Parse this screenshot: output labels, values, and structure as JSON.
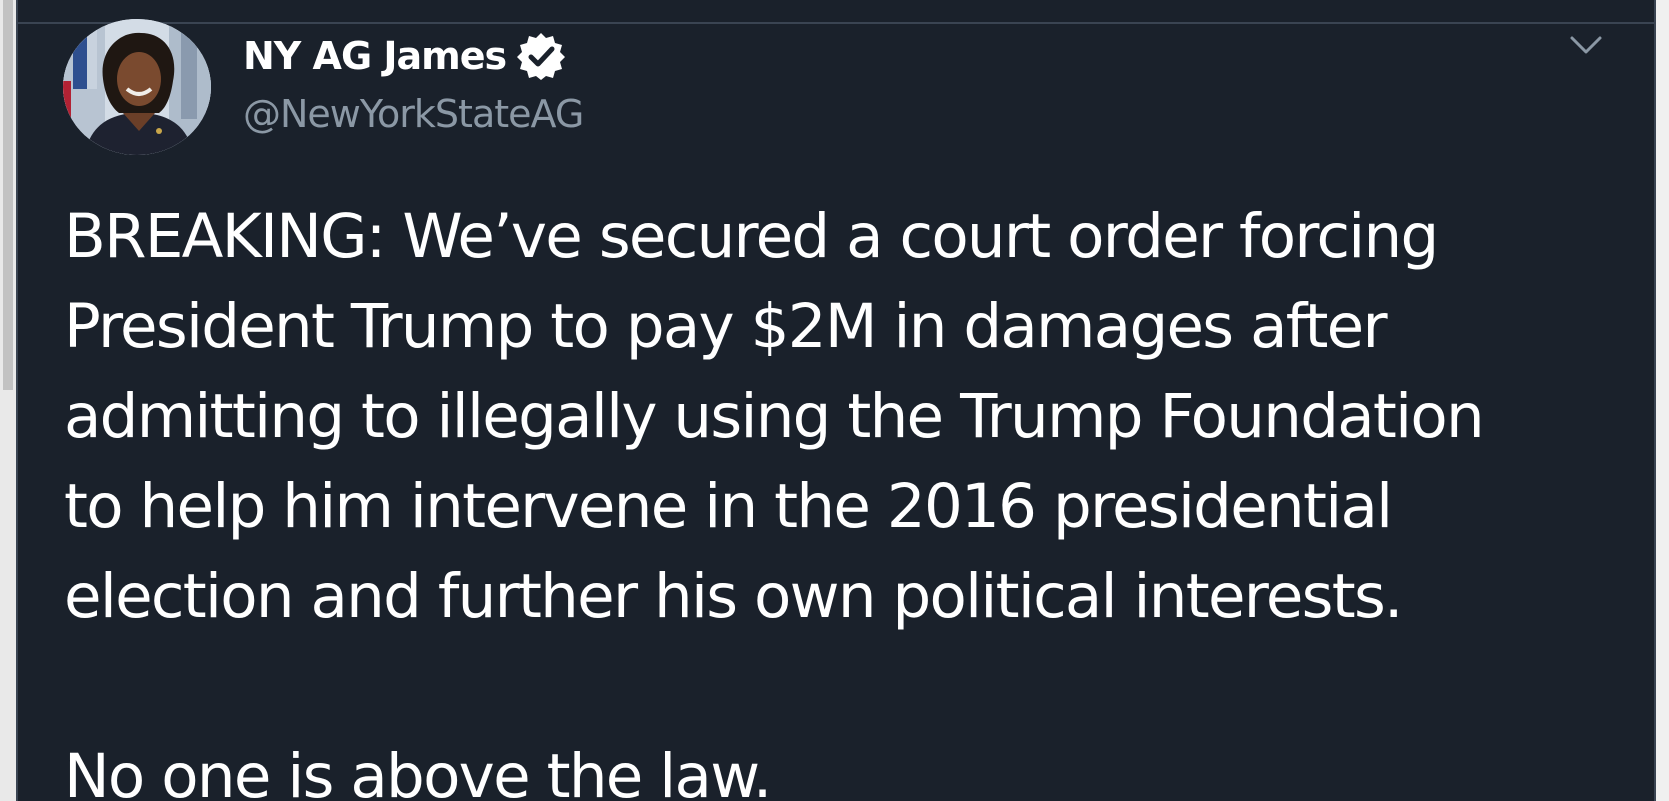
{
  "tweet": {
    "author": {
      "display_name": "NY AG James",
      "handle": "@NewYorkStateAG",
      "verified": true,
      "avatar_icon": "profile-photo"
    },
    "menu_icon": "chevron-down-icon",
    "text_lines": [
      "BREAKING: We’ve secured a court order forcing",
      "President Trump to pay $2M in damages after",
      "admitting to illegally using the Trump Foundation",
      "to help him intervene in the 2016 presidential",
      "election and further his own political interests."
    ],
    "text_after_break": "No one is above the law."
  },
  "colors": {
    "background": "#1a212b",
    "text_primary": "#ffffff",
    "text_secondary": "#8b98a5",
    "border": "#3a4452"
  }
}
